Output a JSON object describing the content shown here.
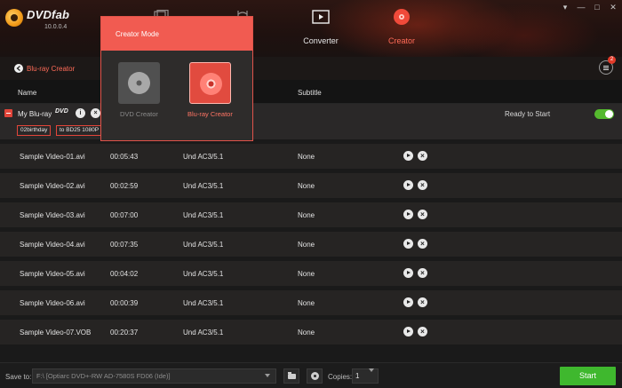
{
  "app": {
    "logo_name": "DVDfab",
    "version": "10.0.0.4"
  },
  "nav": {
    "converter_label": "Converter",
    "creator_label": "Creator",
    "active": "Creator"
  },
  "breadcrumb": {
    "label": "Blu-ray Creator"
  },
  "queue": {
    "badge_count": "2"
  },
  "columns": {
    "name": "Name",
    "subtitle": "Subtitle"
  },
  "title": {
    "name": "My Blu-ray",
    "badge": "DVD",
    "info_icon": "i",
    "close_icon": "×",
    "tag_title": "02birthday",
    "tag_output": "to BD25 1080P",
    "status": "Ready to Start",
    "toggle_on": true
  },
  "videos": [
    {
      "name": "Sample Video-01.avi",
      "duration": "00:05:43",
      "audio": "Und AC3/5.1",
      "subtitle": "None"
    },
    {
      "name": "Sample Video-02.avi",
      "duration": "00:02:59",
      "audio": "Und AC3/5.1",
      "subtitle": "None"
    },
    {
      "name": "Sample Video-03.avi",
      "duration": "00:07:00",
      "audio": "Und AC3/5.1",
      "subtitle": "None"
    },
    {
      "name": "Sample Video-04.avi",
      "duration": "00:07:35",
      "audio": "Und AC3/5.1",
      "subtitle": "None"
    },
    {
      "name": "Sample Video-05.avi",
      "duration": "00:04:02",
      "audio": "Und AC3/5.1",
      "subtitle": "None"
    },
    {
      "name": "Sample Video-06.avi",
      "duration": "00:00:39",
      "audio": "Und AC3/5.1",
      "subtitle": "None"
    },
    {
      "name": "Sample Video-07.VOB",
      "duration": "00:20:37",
      "audio": "Und AC3/5.1",
      "subtitle": "None"
    }
  ],
  "footer": {
    "save_label": "Save to:",
    "save_path": "F:\\ [Optiarc DVD+-RW AD-7580S FD06 (Ide)]",
    "copies_label": "Copies:",
    "copies_value": "1",
    "start_label": "Start"
  },
  "creator_popup": {
    "title": "Creator Mode",
    "dvd_label": "DVD Creator",
    "bluray_label": "Blu-ray Creator",
    "selected": "Blu-ray Creator"
  },
  "colors": {
    "accent": "#f15b51",
    "start_green": "#3fb82e",
    "toggle_green": "#55b92e"
  }
}
